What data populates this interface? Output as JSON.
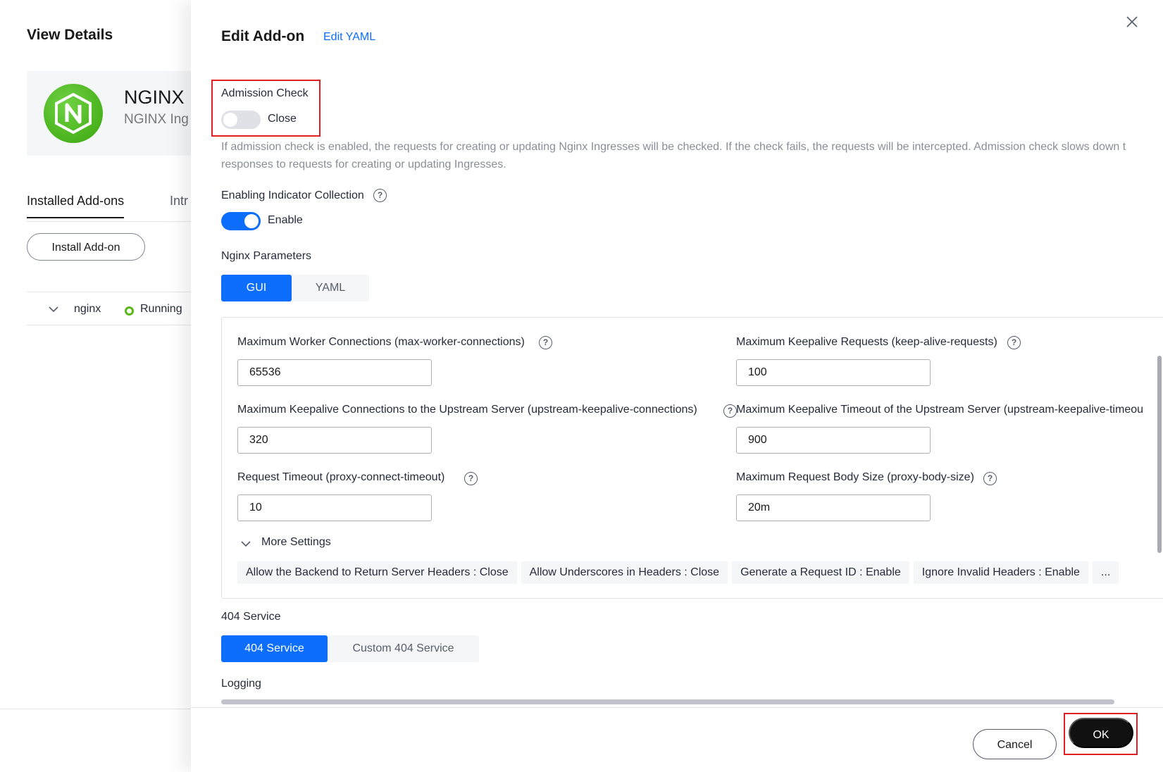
{
  "background_page": {
    "title": "View Details",
    "addon_card": {
      "name": "NGINX",
      "subtitle": "NGINX Ing"
    },
    "tabs": [
      {
        "label": "Installed Add-ons",
        "active": true
      },
      {
        "label": "Intr",
        "active": false
      }
    ],
    "install_button": "Install Add-on",
    "addon_row": {
      "name": "nginx",
      "status": "Running",
      "status_color": "#5ab716"
    }
  },
  "drawer": {
    "title": "Edit Add-on",
    "edit_yaml_link": "Edit YAML",
    "admission_check": {
      "label": "Admission Check",
      "state": "Close",
      "enabled": false,
      "description": "If admission check is enabled, the requests for creating or updating Nginx Ingresses will be checked. If the check fails, the requests will be intercepted. Admission check slows down t responses to requests for creating or updating Ingresses."
    },
    "indicator_collection": {
      "label": "Enabling Indicator Collection",
      "state": "Enable",
      "enabled": true
    },
    "nginx_parameters": {
      "label": "Nginx Parameters",
      "modes": [
        {
          "label": "GUI",
          "active": true
        },
        {
          "label": "YAML",
          "active": false
        }
      ],
      "fields": {
        "max_worker_connections": {
          "label": "Maximum Worker Connections (max-worker-connections)",
          "value": "65536"
        },
        "max_keepalive_requests": {
          "label": "Maximum Keepalive Requests (keep-alive-requests)",
          "value": "100"
        },
        "upstream_keepalive_connections": {
          "label": "Maximum Keepalive Connections to the Upstream Server (upstream-keepalive-connections)",
          "value": "320"
        },
        "upstream_keepalive_timeout": {
          "label": "Maximum Keepalive Timeout of the Upstream Server (upstream-keepalive-timeou",
          "value": "900"
        },
        "request_timeout": {
          "label": "Request Timeout (proxy-connect-timeout)",
          "value": "10"
        },
        "max_request_body_size": {
          "label": "Maximum Request Body Size (proxy-body-size)",
          "value": "20m"
        }
      },
      "more_settings": {
        "label": "More Settings",
        "tags": [
          "Allow the Backend to Return Server Headers : Close",
          "Allow Underscores in Headers : Close",
          "Generate a Request ID : Enable",
          "Ignore Invalid Headers : Enable",
          "..."
        ]
      }
    },
    "service_404": {
      "label": "404 Service",
      "options": [
        {
          "label": "404 Service",
          "active": true
        },
        {
          "label": "Custom 404 Service",
          "active": false
        }
      ]
    },
    "logging_label": "Logging",
    "footer": {
      "cancel": "Cancel",
      "ok": "OK"
    },
    "colors": {
      "accent": "#0d6efd",
      "highlight": "#e02020",
      "primary_button": "#111111"
    }
  }
}
